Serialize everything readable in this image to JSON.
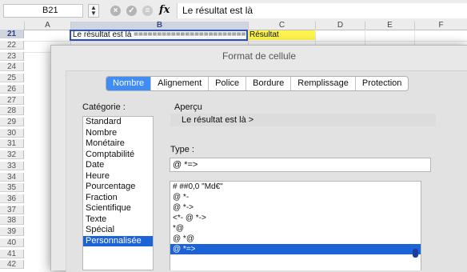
{
  "formula_bar": {
    "cell_ref": "B21",
    "fx_label": "fx",
    "content": "Le résultat est là"
  },
  "sheet": {
    "columns": [
      "A",
      "B",
      "C",
      "D",
      "E",
      "F"
    ],
    "selected_column": "B",
    "rows": [
      "21",
      "22",
      "23",
      "24",
      "25",
      "26",
      "27",
      "28",
      "29",
      "30",
      "31",
      "32",
      "33",
      "34",
      "35",
      "36",
      "37",
      "38",
      "39",
      "40",
      "41",
      "42"
    ],
    "selected_row": "21",
    "cell_b21": "Le résultat est là ======================== >",
    "cell_c21": "Résultat",
    "colors": {
      "selection_border": "#2f53c7",
      "highlight": "#fff44f"
    }
  },
  "dialog": {
    "title": "Format de cellule",
    "tabs": [
      "Nombre",
      "Alignement",
      "Police",
      "Bordure",
      "Remplissage",
      "Protection"
    ],
    "active_tab": "Nombre",
    "category_label": "Catégorie :",
    "categories": [
      "Standard",
      "Nombre",
      "Monétaire",
      "Comptabilité",
      "Date",
      "Heure",
      "Pourcentage",
      "Fraction",
      "Scientifique",
      "Texte",
      "Spécial",
      "Personnalisée"
    ],
    "selected_category": "Personnalisée",
    "preview_label": "Aperçu",
    "preview_value": "Le résultat est là >",
    "type_label": "Type :",
    "type_value": "@ *=>",
    "formats": [
      "# ##0,0   \"Md€\"",
      "@ *-",
      "@ *->",
      "<*- @ *->",
      "*@",
      "@ *@",
      "@ *=>"
    ],
    "selected_format": "@ *=>",
    "colors": {
      "accent": "#3f8cf5",
      "list_selection": "#1b63d6"
    }
  }
}
